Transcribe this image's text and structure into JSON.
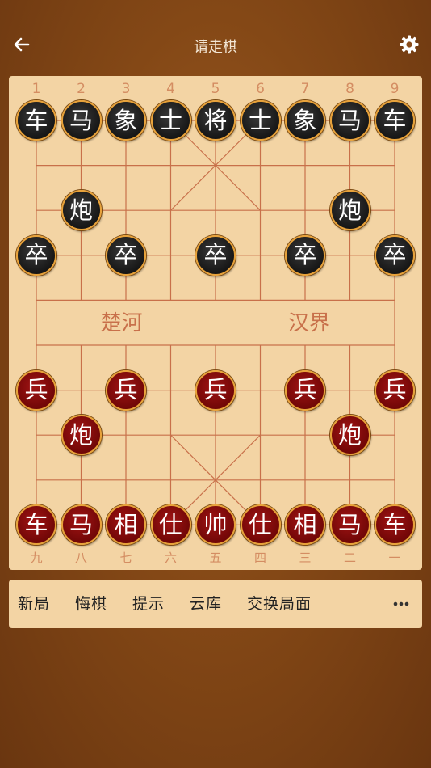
{
  "header": {
    "title": "请走棋",
    "back_icon": "arrow-left-icon",
    "settings_icon": "gear-icon"
  },
  "board": {
    "top_coords": [
      "1",
      "2",
      "3",
      "4",
      "5",
      "6",
      "7",
      "8",
      "9"
    ],
    "bottom_coords": [
      "九",
      "八",
      "七",
      "六",
      "五",
      "四",
      "三",
      "二",
      "一"
    ],
    "river_left": "楚河",
    "river_right": "汉界",
    "pieces": [
      {
        "side": "black",
        "char": "车",
        "file": 0,
        "rank": 0
      },
      {
        "side": "black",
        "char": "马",
        "file": 1,
        "rank": 0
      },
      {
        "side": "black",
        "char": "象",
        "file": 2,
        "rank": 0
      },
      {
        "side": "black",
        "char": "士",
        "file": 3,
        "rank": 0
      },
      {
        "side": "black",
        "char": "将",
        "file": 4,
        "rank": 0
      },
      {
        "side": "black",
        "char": "士",
        "file": 5,
        "rank": 0
      },
      {
        "side": "black",
        "char": "象",
        "file": 6,
        "rank": 0
      },
      {
        "side": "black",
        "char": "马",
        "file": 7,
        "rank": 0
      },
      {
        "side": "black",
        "char": "车",
        "file": 8,
        "rank": 0
      },
      {
        "side": "black",
        "char": "炮",
        "file": 1,
        "rank": 2
      },
      {
        "side": "black",
        "char": "炮",
        "file": 7,
        "rank": 2
      },
      {
        "side": "black",
        "char": "卒",
        "file": 0,
        "rank": 3
      },
      {
        "side": "black",
        "char": "卒",
        "file": 2,
        "rank": 3
      },
      {
        "side": "black",
        "char": "卒",
        "file": 4,
        "rank": 3
      },
      {
        "side": "black",
        "char": "卒",
        "file": 6,
        "rank": 3
      },
      {
        "side": "black",
        "char": "卒",
        "file": 8,
        "rank": 3
      },
      {
        "side": "red",
        "char": "兵",
        "file": 0,
        "rank": 6
      },
      {
        "side": "red",
        "char": "兵",
        "file": 2,
        "rank": 6
      },
      {
        "side": "red",
        "char": "兵",
        "file": 4,
        "rank": 6
      },
      {
        "side": "red",
        "char": "兵",
        "file": 6,
        "rank": 6
      },
      {
        "side": "red",
        "char": "兵",
        "file": 8,
        "rank": 6
      },
      {
        "side": "red",
        "char": "炮",
        "file": 1,
        "rank": 7
      },
      {
        "side": "red",
        "char": "炮",
        "file": 7,
        "rank": 7
      },
      {
        "side": "red",
        "char": "车",
        "file": 0,
        "rank": 9
      },
      {
        "side": "red",
        "char": "马",
        "file": 1,
        "rank": 9
      },
      {
        "side": "red",
        "char": "相",
        "file": 2,
        "rank": 9
      },
      {
        "side": "red",
        "char": "仕",
        "file": 3,
        "rank": 9
      },
      {
        "side": "red",
        "char": "帅",
        "file": 4,
        "rank": 9
      },
      {
        "side": "red",
        "char": "仕",
        "file": 5,
        "rank": 9
      },
      {
        "side": "red",
        "char": "相",
        "file": 6,
        "rank": 9
      },
      {
        "side": "red",
        "char": "马",
        "file": 7,
        "rank": 9
      },
      {
        "side": "red",
        "char": "车",
        "file": 8,
        "rank": 9
      }
    ]
  },
  "toolbar": {
    "new_game": "新局",
    "undo": "悔棋",
    "hint": "提示",
    "cloud": "云库",
    "swap": "交换局面",
    "more_icon": "more-horizontal-icon"
  },
  "colors": {
    "board": "#f3d4a4",
    "grid": "#c8704a",
    "black_piece": "#1c1c1c",
    "red_piece": "#8a0c0c",
    "piece_rim": "#e8a23a"
  }
}
